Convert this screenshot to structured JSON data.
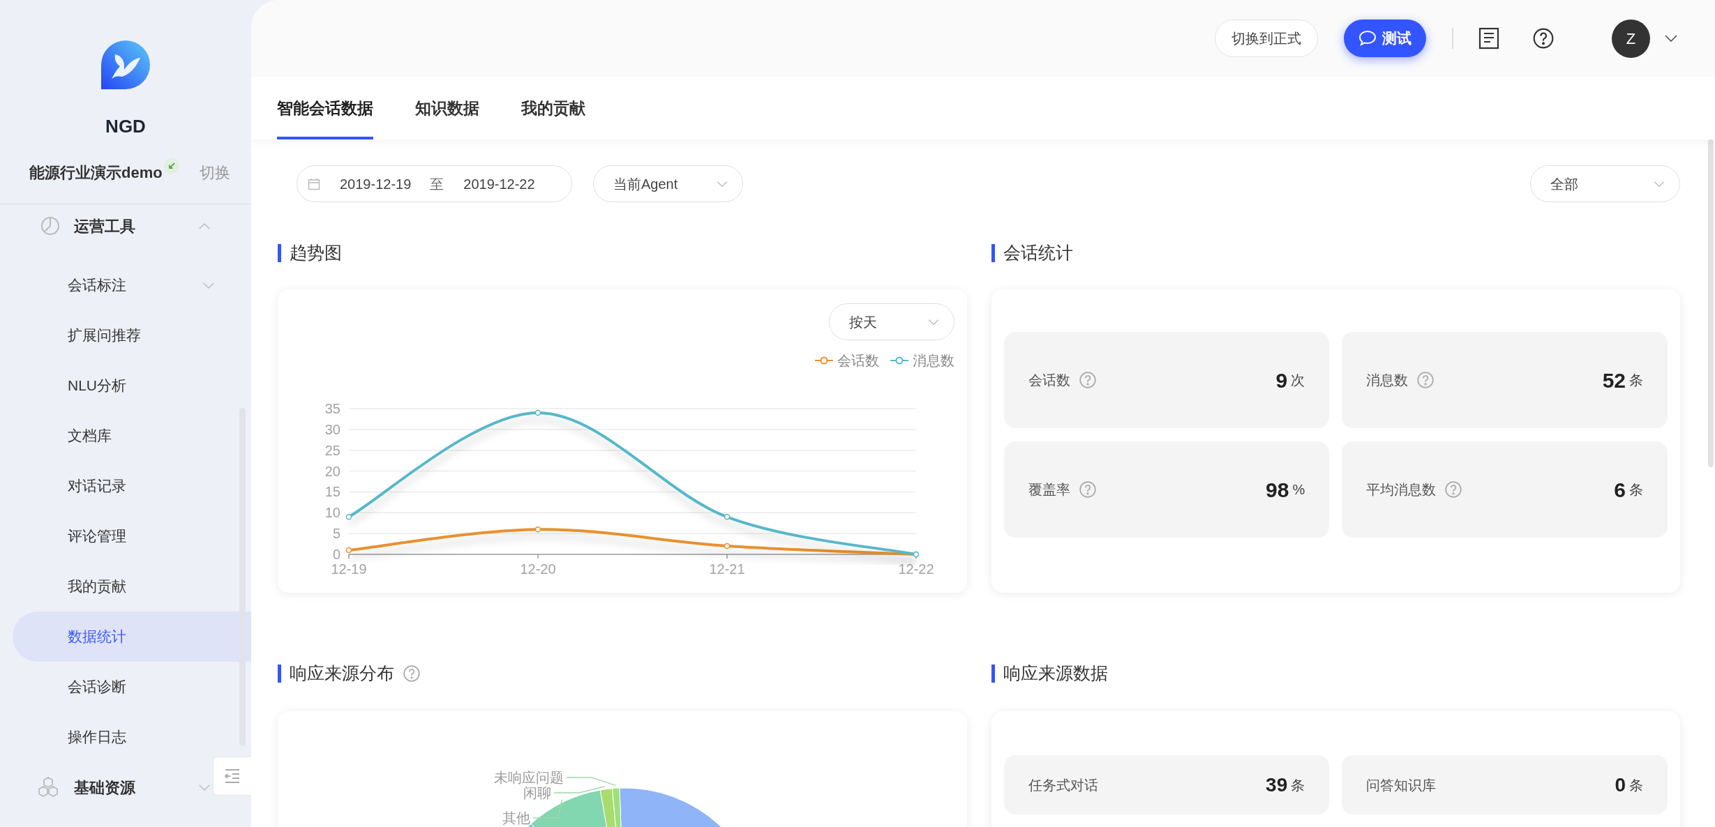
{
  "sidebar": {
    "brand": "NGD",
    "project": {
      "name": "能源行业演示demo",
      "switch_label": "切换"
    },
    "groups": [
      {
        "label": "运营工具",
        "expanded": true,
        "children": [
          {
            "label": "会话标注",
            "kind": "submenu",
            "expanded": false,
            "selected": false
          },
          {
            "label": "扩展问推荐",
            "kind": "link",
            "selected": false
          },
          {
            "label": "NLU分析",
            "kind": "link",
            "selected": false
          },
          {
            "label": "文档库",
            "kind": "link",
            "selected": false
          },
          {
            "label": "对话记录",
            "kind": "link",
            "selected": false
          },
          {
            "label": "评论管理",
            "kind": "link",
            "selected": false
          },
          {
            "label": "我的贡献",
            "kind": "link",
            "selected": false
          },
          {
            "label": "数据统计",
            "kind": "link",
            "selected": true
          },
          {
            "label": "会话诊断",
            "kind": "link",
            "selected": false
          },
          {
            "label": "操作日志",
            "kind": "link",
            "selected": false
          }
        ]
      },
      {
        "label": "基础资源",
        "expanded": false
      }
    ]
  },
  "topbar": {
    "switch_button": "切换到正式",
    "test_button": "测试",
    "avatar": "Z"
  },
  "tabs": [
    {
      "label": "智能会话数据",
      "selected": true
    },
    {
      "label": "知识数据",
      "selected": false
    },
    {
      "label": "我的贡献",
      "selected": false
    }
  ],
  "filters": {
    "date_start": "2019-12-19",
    "date_separator": "至",
    "date_end": "2019-12-22",
    "agent": "当前Agent",
    "scope": "全部"
  },
  "trend": {
    "title": "趋势图",
    "granularity": "按天",
    "chart_data": {
      "type": "line",
      "grid": true,
      "categories": [
        "12-19",
        "12-20",
        "12-21",
        "12-22"
      ],
      "series": [
        {
          "name": "会话数",
          "color": "#e8912e",
          "marker": true,
          "values": [
            1,
            6,
            2,
            0
          ]
        },
        {
          "name": "消息数",
          "color": "#56b8c9",
          "marker": true,
          "values": [
            9,
            34,
            9,
            0
          ]
        }
      ],
      "ylim": [
        0,
        35
      ],
      "yticks": [
        0,
        5,
        10,
        15,
        20,
        25,
        30,
        35
      ]
    }
  },
  "session_stats": {
    "title": "会话统计",
    "tiles": [
      {
        "label": "会话数",
        "value": "9",
        "unit": "次"
      },
      {
        "label": "消息数",
        "value": "52",
        "unit": "条"
      },
      {
        "label": "覆盖率",
        "value": "98",
        "unit": "%"
      },
      {
        "label": "平均消息数",
        "value": "6",
        "unit": "条"
      }
    ]
  },
  "response_distribution": {
    "title": "响应来源分布",
    "has_help": true,
    "pie_labels": [
      "未响应问题",
      "闲聊",
      "其他"
    ]
  },
  "response_data": {
    "title": "响应来源数据",
    "tiles": [
      {
        "label": "任务式对话",
        "value": "39",
        "unit": "条"
      },
      {
        "label": "问答知识库",
        "value": "0",
        "unit": "条"
      }
    ]
  }
}
